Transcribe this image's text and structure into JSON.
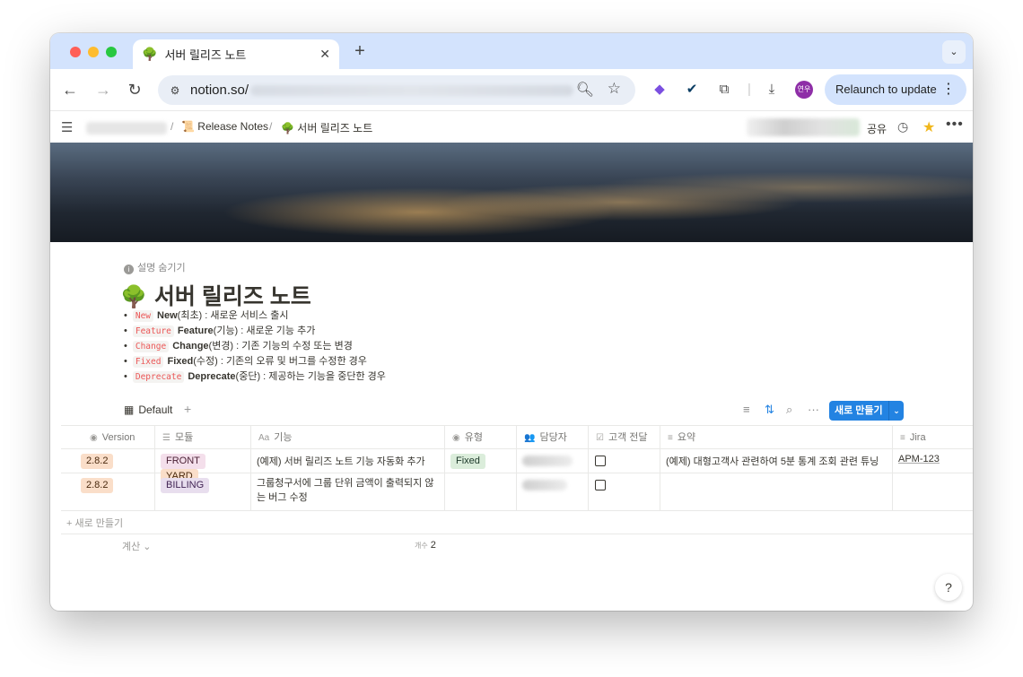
{
  "browser": {
    "tab_title": "서버 릴리즈 노트",
    "tab_icon": "🌳",
    "url": "notion.so/",
    "relaunch_label": "Relaunch to update",
    "profile_initials": "연우"
  },
  "notion": {
    "breadcrumb": [
      {
        "icon": "📜",
        "label": "Release Notes"
      },
      {
        "icon": "🌳",
        "label": "서버 릴리즈 노트"
      }
    ],
    "share_label": "공유"
  },
  "page": {
    "hide_description": "설명 숨기기",
    "title_icon": "🌳",
    "title": "서버 릴리즈 노트",
    "legend": [
      {
        "code": "New",
        "bold": "New",
        "text": "(최초) : 새로운 서비스 출시"
      },
      {
        "code": "Feature",
        "bold": "Feature",
        "text": "(기능) : 새로운 기능 추가"
      },
      {
        "code": "Change",
        "bold": "Change",
        "text": "(변경) : 기존 기능의 수정 또는 변경"
      },
      {
        "code": "Fixed",
        "bold": "Fixed",
        "text": "(수정) : 기존의 오류 및 버그를 수정한 경우"
      },
      {
        "code": "Deprecate",
        "bold": "Deprecate",
        "text": "(중단) : 제공하는 기능을 중단한 경우"
      }
    ]
  },
  "database": {
    "view_name": "Default",
    "new_button": "새로 만들기",
    "columns": [
      {
        "icon": "◉",
        "label": "Version"
      },
      {
        "icon": "☰",
        "label": "모듈"
      },
      {
        "icon": "Aa",
        "label": "기능"
      },
      {
        "icon": "◉",
        "label": "유형"
      },
      {
        "icon": "👥",
        "label": "담당자"
      },
      {
        "icon": "☑",
        "label": "고객 전달"
      },
      {
        "icon": "≡",
        "label": "요약"
      },
      {
        "icon": "≡",
        "label": "Jira"
      }
    ],
    "rows": [
      {
        "version": "2.8.2",
        "modules": [
          "FRONT",
          "YARD"
        ],
        "feature": "(예제) 서버 릴리즈 노트 기능 자동화 추가",
        "type": "Fixed",
        "summary": "(예제) 대형고객사 관련하여 5분 통계 조회 관련 튜닝",
        "jira": "APM-123"
      },
      {
        "version": "2.8.2",
        "modules": [
          "BILLING"
        ],
        "feature": "그룹청구서에 그룹 단위 금액이 출력되지 않는 버그 수정",
        "type": "",
        "summary": "",
        "jira": ""
      }
    ],
    "add_row_label": "새로 만들기",
    "calc_label": "계산",
    "count_label": "개수",
    "count_value": "2"
  },
  "help_label": "?"
}
